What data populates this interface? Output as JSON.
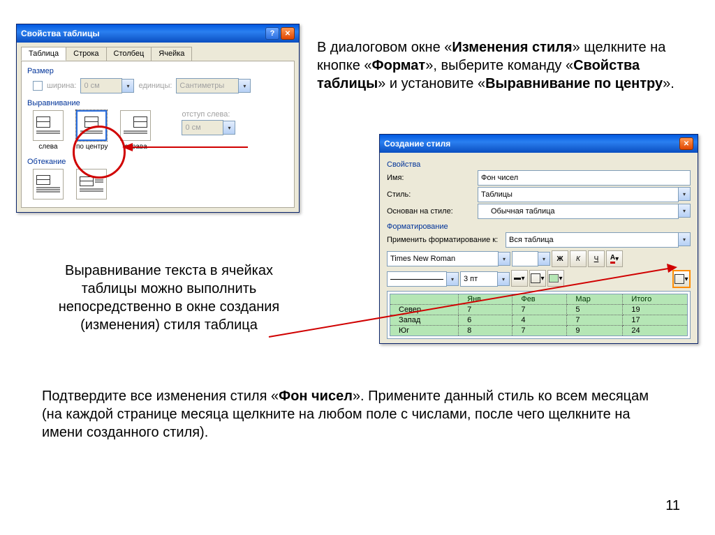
{
  "dlg1": {
    "title": "Свойства таблицы",
    "tabs": [
      "Таблица",
      "Строка",
      "Столбец",
      "Ячейка"
    ],
    "size_group": "Размер",
    "width_chk": "ширина:",
    "width_val": "0 см",
    "units_label": "единицы:",
    "units_val": "Сантиметры",
    "align_group": "Выравнивание",
    "indent_label": "отступ слева:",
    "indent_val": "0 см",
    "opt_left": "слева",
    "opt_center": "по центру",
    "opt_right": "справа",
    "wrap_group": "Обтекание"
  },
  "para1": {
    "t1": " В диалоговом окне «",
    "b1": "Изменения стиля",
    "t2": "» щелкните на кнопке «",
    "b2": "Формат",
    "t3": "», выберите команду  «",
    "b3": "Свойства таблицы",
    "t4": "» и установите «",
    "b4": "Выравнивание по центру",
    "t5": "»."
  },
  "para2": "Выравнивание текста в ячейках таблицы можно выполнить непосредственно в окне создания (изменения) стиля таблица",
  "para3": {
    "t1": "Подвердите все изменения стиля «",
    "b1": "Фон чисел",
    "t2": "». Примените данный стиль ко всем месяцам (на каждой странице месяца щелкните на любом поле с числами, после чего щелкните на имени созданного стиля)."
  },
  "para3_full_t1": "Подтвердите все изменения стиля «",
  "dlg2": {
    "title": "Создание стиля",
    "props": "Свойства",
    "name_l": "Имя:",
    "name_v": "Фон чисел",
    "style_l": "Стиль:",
    "style_v": "Таблицы",
    "based_l": "Основан на стиле:",
    "based_v": "Обычная таблица",
    "fmt_group": "Форматирование",
    "apply_l": "Применить форматирование к:",
    "apply_v": "Вся таблица",
    "font": "Times New Roman",
    "pt": "3 пт",
    "b": "Ж",
    "i": "К",
    "u": "Ч",
    "preview": {
      "headers": [
        "",
        "Янв",
        "Фев",
        "Мар",
        "Итого"
      ],
      "rows": [
        [
          "Север",
          "7",
          "7",
          "5",
          "19"
        ],
        [
          "Запад",
          "6",
          "4",
          "7",
          "17"
        ],
        [
          "Юг",
          "8",
          "7",
          "9",
          "24"
        ]
      ]
    }
  },
  "pagenum": "11"
}
